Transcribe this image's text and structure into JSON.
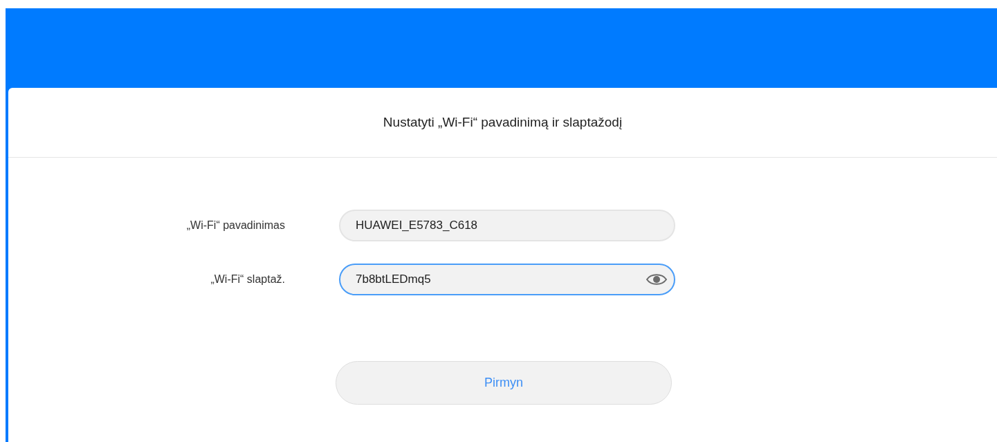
{
  "dialog": {
    "title": "Nustatyti „Wi-Fi“ pavadinimą ir slaptažodį"
  },
  "fields": [
    {
      "label": "„Wi-Fi“ pavadinimas",
      "value": "HUAWEI_E5783_C618",
      "focused": false,
      "kind": "text"
    },
    {
      "label": "„Wi-Fi“ slaptaž.",
      "value": "7b8btLEDmq5",
      "focused": true,
      "kind": "password"
    }
  ],
  "next_button": {
    "label": "Pirmyn"
  }
}
